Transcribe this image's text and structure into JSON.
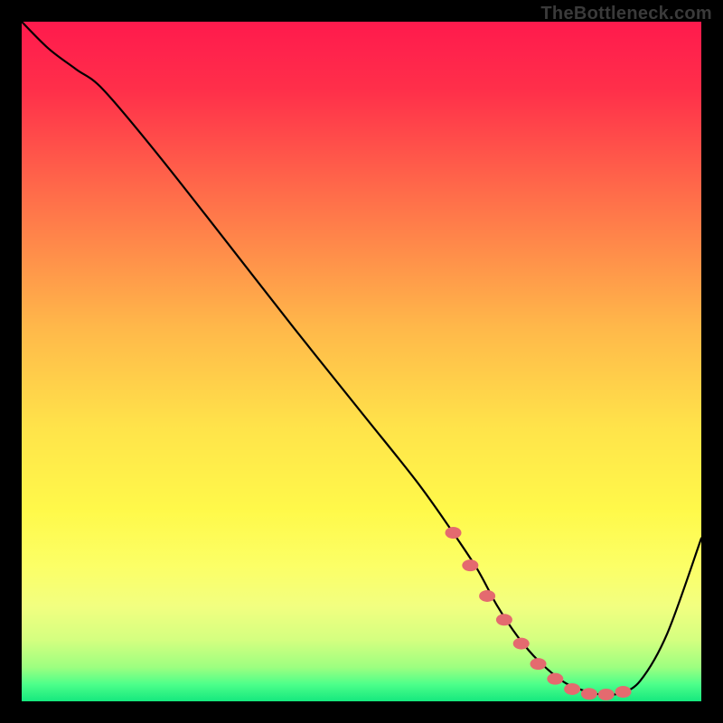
{
  "watermark": "TheBottleneck.com",
  "chart_data": {
    "type": "line",
    "title": "",
    "xlabel": "",
    "ylabel": "",
    "xlim": [
      0,
      100
    ],
    "ylim": [
      0,
      100
    ],
    "gradient_stops": [
      {
        "offset": 0,
        "color": "#ff1a4d"
      },
      {
        "offset": 0.1,
        "color": "#ff2f4a"
      },
      {
        "offset": 0.25,
        "color": "#ff6b4a"
      },
      {
        "offset": 0.45,
        "color": "#ffb84a"
      },
      {
        "offset": 0.6,
        "color": "#ffe44a"
      },
      {
        "offset": 0.72,
        "color": "#fff94a"
      },
      {
        "offset": 0.8,
        "color": "#fcff66"
      },
      {
        "offset": 0.86,
        "color": "#f2ff80"
      },
      {
        "offset": 0.91,
        "color": "#d4ff80"
      },
      {
        "offset": 0.95,
        "color": "#9dff80"
      },
      {
        "offset": 0.975,
        "color": "#4dff8a"
      },
      {
        "offset": 1.0,
        "color": "#15e87e"
      }
    ],
    "series": [
      {
        "name": "curve",
        "x": [
          0,
          4,
          8,
          12,
          20,
          30,
          40,
          50,
          58,
          63,
          67,
          70,
          73,
          76,
          80,
          84,
          86,
          88,
          91,
          95,
          100
        ],
        "y": [
          100,
          96,
          93,
          90,
          80.5,
          67.8,
          55,
          42.5,
          32.5,
          25.5,
          19.5,
          14,
          9.5,
          6,
          2.7,
          1.2,
          1.0,
          1.2,
          3,
          10,
          24
        ]
      }
    ],
    "markers": {
      "name": "dots",
      "color": "#e46a6f",
      "x": [
        63.5,
        66,
        68.5,
        71,
        73.5,
        76,
        78.5,
        81,
        83.5,
        86,
        88.5
      ],
      "y": [
        24.8,
        20.0,
        15.5,
        12.0,
        8.5,
        5.5,
        3.3,
        1.8,
        1.1,
        1.0,
        1.4
      ]
    }
  }
}
